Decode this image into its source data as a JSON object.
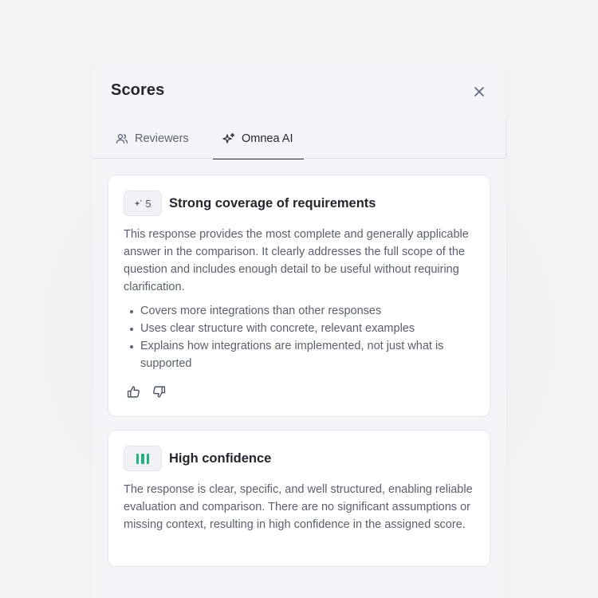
{
  "panel": {
    "title": "Scores",
    "close_icon": "close-icon"
  },
  "tabs": [
    {
      "label": "Reviewers",
      "icon": "users-icon",
      "active": false
    },
    {
      "label": "Omnea AI",
      "icon": "sparkles-icon",
      "active": true
    }
  ],
  "score_card": {
    "badge_icon": "sparkle-icon",
    "score": "5",
    "title": "Strong coverage of requirements",
    "body": "This response provides the most complete and generally applicable answer in the comparison. It clearly addresses the full scope of the question and includes enough detail to be useful without requiring clarification.",
    "bullets": [
      "Covers more integrations than other responses",
      "Uses clear structure with concrete, relevant examples",
      "Explains how integrations are implemented, not just what is supported"
    ],
    "feedback": [
      "thumbs-up-icon",
      "thumbs-down-icon"
    ]
  },
  "confidence_card": {
    "badge_icon": "confidence-bars-icon",
    "level_bars": 3,
    "accent_color": "#22b07d",
    "title": "High confidence",
    "body": "The response is clear, specific, and well structured, enabling reliable evaluation and comparison. There are no significant assumptions or missing context, resulting in high confidence in the assigned score."
  }
}
